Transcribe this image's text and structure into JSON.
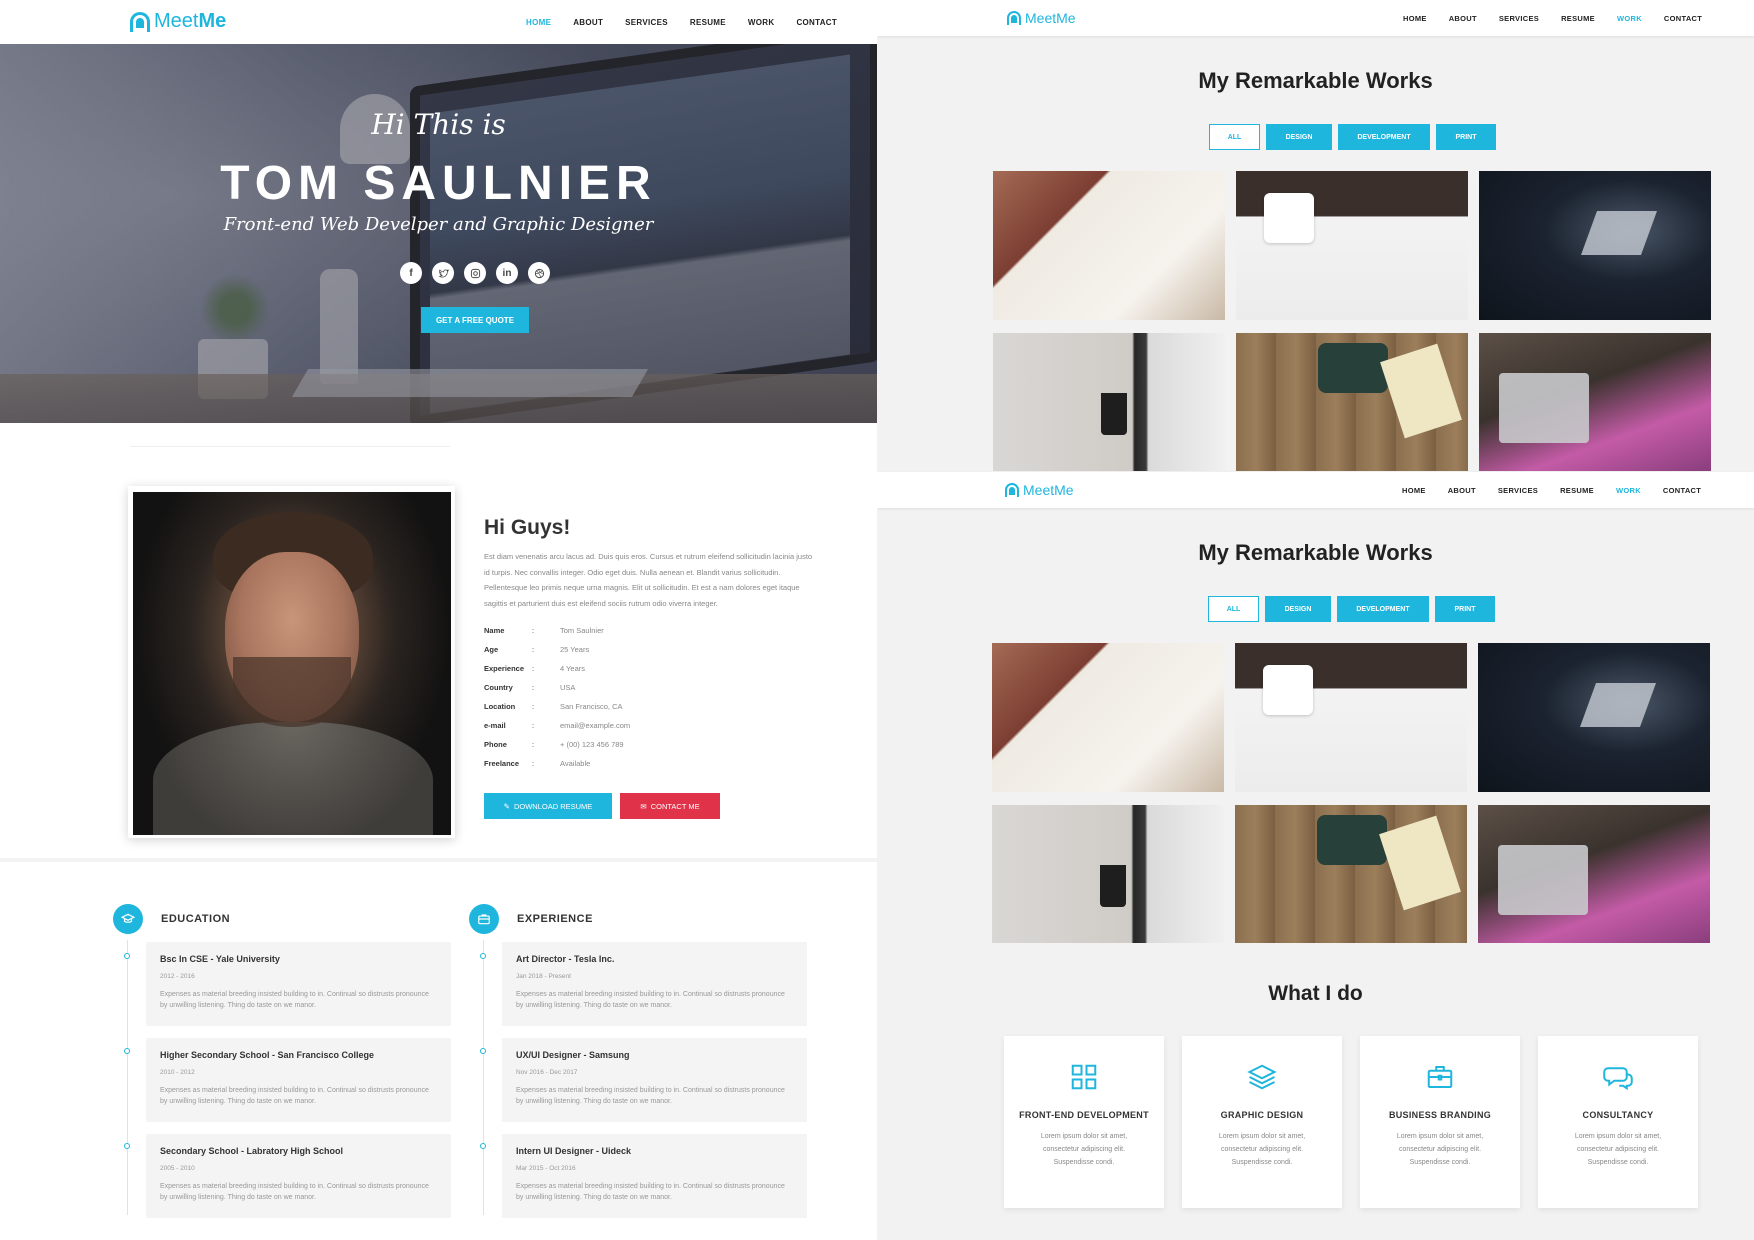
{
  "brand": {
    "part1": "Meet",
    "part2": "Me"
  },
  "left_nav": {
    "items": [
      "HOME",
      "ABOUT",
      "SERVICES",
      "RESUME",
      "WORK",
      "CONTACT"
    ],
    "active": "HOME"
  },
  "hero": {
    "greeting": "Hi This is",
    "name": "TOM SAULNIER",
    "subtitle": "Front-end Web Develper and Graphic Designer",
    "socials": [
      "facebook-icon",
      "twitter-icon",
      "instagram-icon",
      "linkedin-icon",
      "dribbble-icon"
    ],
    "cta": "GET A FREE QUOTE"
  },
  "about": {
    "title": "Hi Guys!",
    "text": "Est diam venenatis arcu lacus ad. Duis quis eros. Cursus et rutrum eleifend sollicitudin lacinia justo id turpis. Nec convallis integer. Odio eget duis. Nulla aenean et. Blandit varius sollicitudin. Pellentesque leo primis neque urna magnis. Elit ut sollicitudin. Et est a nam dolores eget itaque sagittis et parturient duis est eleifend sociis rutrum odio viverra integer.",
    "info": [
      {
        "key": "Name",
        "value": "Tom Saulnier"
      },
      {
        "key": "Age",
        "value": "25 Years"
      },
      {
        "key": "Experience",
        "value": "4 Years"
      },
      {
        "key": "Country",
        "value": "USA"
      },
      {
        "key": "Location",
        "value": "San Francisco, CA"
      },
      {
        "key": "e-mail",
        "value": "email@example.com"
      },
      {
        "key": "Phone",
        "value": "+ (00) 123 456 789"
      },
      {
        "key": "Freelance",
        "value": "Available"
      }
    ],
    "colon": ":",
    "download_label": "DOWNLOAD RESUME",
    "contact_label": "CONTACT ME"
  },
  "resume": {
    "education": {
      "title": "EDUCATION",
      "items": [
        {
          "title": "Bsc In CSE - Yale University",
          "date": "2012 - 2016",
          "text": "Expenses as material breeding insisted building to in. Continual so distrusts pronounce by unwilling listening. Thing do taste on we manor."
        },
        {
          "title": "Higher Secondary School - San Francisco College",
          "date": "2010 - 2012",
          "text": "Expenses as material breeding insisted building to in. Continual so distrusts pronounce by unwilling listening. Thing do taste on we manor."
        },
        {
          "title": "Secondary School - Labratory High School",
          "date": "2005 - 2010",
          "text": "Expenses as material breeding insisted building to in. Continual so distrusts pronounce by unwilling listening. Thing do taste on we manor."
        }
      ]
    },
    "experience": {
      "title": "EXPERIENCE",
      "items": [
        {
          "title": "Art Director - Tesla Inc.",
          "date": "Jan 2018 - Present",
          "text": "Expenses as material breeding insisted building to in. Continual so distrusts pronounce by unwilling listening. Thing do taste on we manor."
        },
        {
          "title": "UX/UI Designer - Samsung",
          "date": "Nov 2016 - Dec 2017",
          "text": "Expenses as material breeding insisted building to in. Continual so distrusts pronounce by unwilling listening. Thing do taste on we manor."
        },
        {
          "title": "Intern UI Designer - Uideck",
          "date": "Mar 2015 - Oct 2016",
          "text": "Expenses as material breeding insisted building to in. Continual so distrusts pronounce by unwilling listening. Thing do taste on we manor."
        }
      ]
    }
  },
  "right_nav": {
    "items": [
      "HOME",
      "ABOUT",
      "SERVICES",
      "RESUME",
      "WORK",
      "CONTACT"
    ],
    "active": "WORK"
  },
  "works": {
    "title": "My Remarkable Works",
    "filters": [
      "ALL",
      "DESIGN",
      "DEVELOPMENT",
      "PRINT"
    ]
  },
  "services": {
    "title": "What I do",
    "items": [
      {
        "icon": "grid-icon",
        "title": "FRONT-END DEVELOPMENT",
        "text": "Lorem ipsum dolor sit amet, consectetur adipiscing elit. Suspendisse condi."
      },
      {
        "icon": "layers-icon",
        "title": "GRAPHIC DESIGN",
        "text": "Lorem ipsum dolor sit amet, consectetur adipiscing elit. Suspendisse condi."
      },
      {
        "icon": "briefcase-icon",
        "title": "BUSINESS BRANDING",
        "text": "Lorem ipsum dolor sit amet, consectetur adipiscing elit. Suspendisse condi."
      },
      {
        "icon": "chat-icon",
        "title": "CONSULTANCY",
        "text": "Lorem ipsum dolor sit amet, consectetur adipiscing elit. Suspendisse condi."
      }
    ]
  },
  "colors": {
    "accent": "#1fb6de",
    "danger": "#e0334a"
  }
}
